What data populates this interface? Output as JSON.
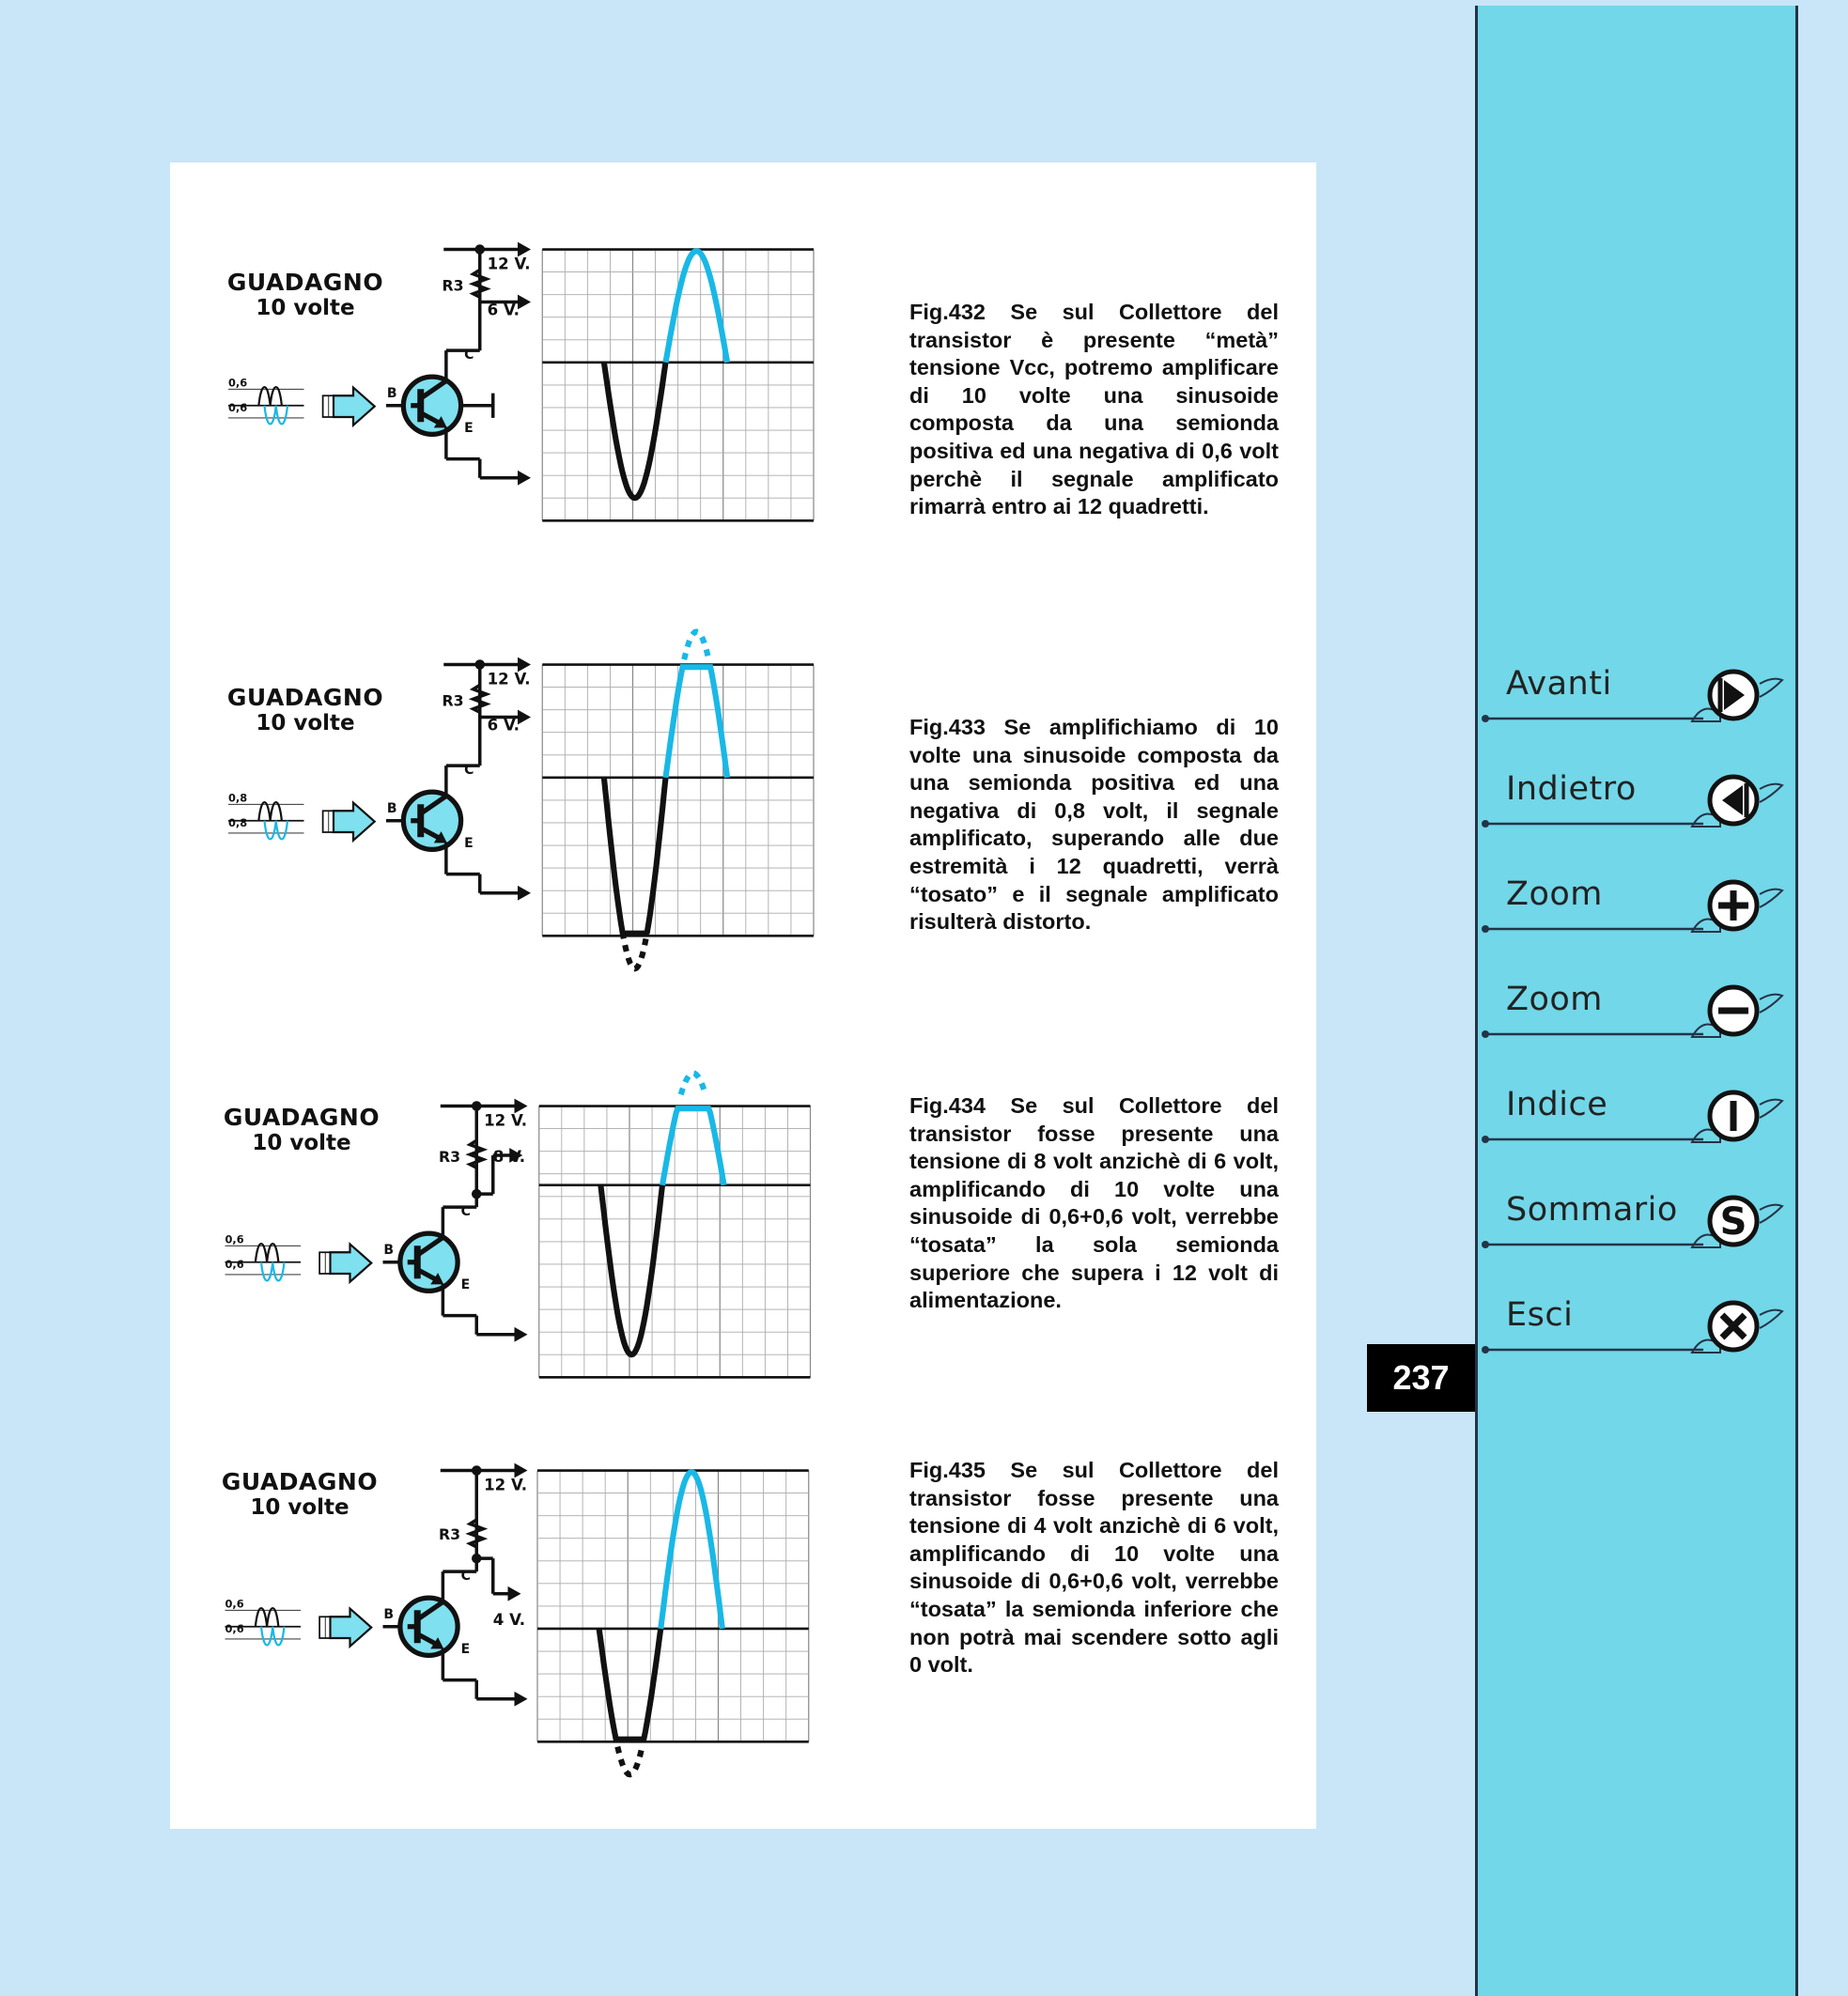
{
  "figures": [
    {
      "gain_title": "GUADAGNO",
      "gain_subtitle": "10 volte",
      "vcc_label": "12 V.",
      "resistor_label": "R3",
      "collector_voltage": "6 V.",
      "base_label": "B",
      "collector_label": "C",
      "emitter_label": "E",
      "input_pos": "0,6",
      "input_neg": "0,6",
      "caption": "Fig.432 Se sul Collettore del transistor è presente “metà” tensione Vcc, potremo amplificare di 10 volte una sinusoide composta da una semionda positiva ed una negativa di 0,6 volt perchè il segnale amplificato rimarrà entro ai 12 quadretti."
    },
    {
      "gain_title": "GUADAGNO",
      "gain_subtitle": "10 volte",
      "vcc_label": "12 V.",
      "resistor_label": "R3",
      "collector_voltage": "6 V.",
      "base_label": "B",
      "collector_label": "C",
      "emitter_label": "E",
      "input_pos": "0,8",
      "input_neg": "0,8",
      "caption": "Fig.433 Se amplifichiamo di 10 volte una sinusoide composta da una semionda positiva ed una negativa di 0,8 volt, il segnale amplificato, superando alle due estremità i 12 quadretti, verrà “tosato” e il segnale amplificato risulterà distorto."
    },
    {
      "gain_title": "GUADAGNO",
      "gain_subtitle": "10 volte",
      "vcc_label": "12 V.",
      "resistor_label": "R3",
      "collector_voltage": "8 V.",
      "base_label": "B",
      "collector_label": "C",
      "emitter_label": "E",
      "input_pos": "0,6",
      "input_neg": "0,6",
      "caption": "Fig.434 Se sul Collettore del transistor fosse presente una tensione di 8 volt anzichè di 6 volt, amplificando di 10 volte una sinusoide di 0,6+0,6 volt, verrebbe “tosata” la sola semionda superiore che supera i 12 volt di alimentazione."
    },
    {
      "gain_title": "GUADAGNO",
      "gain_subtitle": "10 volte",
      "vcc_label": "12 V.",
      "resistor_label": "R3",
      "collector_voltage": "4 V.",
      "base_label": "B",
      "collector_label": "C",
      "emitter_label": "E",
      "input_pos": "0,6",
      "input_neg": "0,6",
      "caption": "Fig.435 Se sul Collettore del transistor fosse presente una tensione di 4 volt anzichè di 6 volt, amplificando di 10 volte una sinusoide di 0,6+0,6 volt, verrebbe “tosata” la semionda inferiore che non potrà mai scendere sotto agli 0 volt."
    }
  ],
  "page_number": "237",
  "nav": [
    {
      "label": "Avanti",
      "icon": "arrow-right-icon"
    },
    {
      "label": "Indietro",
      "icon": "arrow-left-icon"
    },
    {
      "label": "Zoom",
      "icon": "zoom-in-icon"
    },
    {
      "label": "Zoom",
      "icon": "zoom-out-icon"
    },
    {
      "label": "Indice",
      "icon": "index-icon"
    },
    {
      "label": "Sommario",
      "icon": "summary-icon"
    },
    {
      "label": "Esci",
      "icon": "exit-icon"
    }
  ],
  "colors": {
    "background": "#c8e6f7",
    "sidebar": "#72d7e8",
    "signal_positive": "#19b8e6",
    "signal_negative": "#111111",
    "transistor_fill": "#7fe0ef"
  }
}
